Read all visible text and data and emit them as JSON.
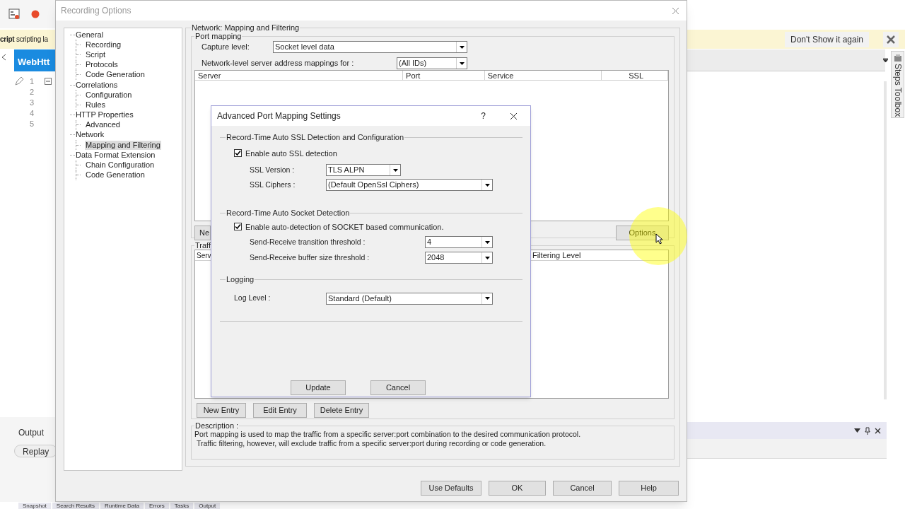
{
  "background_app": {
    "script_banner": "**cript** scripting la",
    "dont_show_button": "Don't Show it again",
    "editor_tab": "WebHtt",
    "line_numbers": [
      "1",
      "2",
      "3",
      "4",
      "5"
    ],
    "steps_toolbox": "Steps Toolbox",
    "output_panel": {
      "title": "Output",
      "replay_button": "Replay"
    },
    "bottom_tabs": [
      "Snapshot",
      "Search Results",
      "Runtime Data",
      "Errors",
      "Tasks",
      "Output"
    ]
  },
  "recording_options": {
    "title": "Recording Options",
    "tree": [
      {
        "label": "General",
        "selected": false,
        "children": [
          {
            "label": "Recording",
            "selected": false
          },
          {
            "label": "Script",
            "selected": false
          },
          {
            "label": "Protocols",
            "selected": false
          },
          {
            "label": "Code Generation",
            "selected": false
          }
        ]
      },
      {
        "label": "Correlations",
        "selected": false,
        "children": [
          {
            "label": "Configuration",
            "selected": false
          },
          {
            "label": "Rules",
            "selected": false
          }
        ]
      },
      {
        "label": "HTTP Properties",
        "selected": false,
        "children": [
          {
            "label": "Advanced",
            "selected": false
          }
        ]
      },
      {
        "label": "Network",
        "selected": false,
        "children": [
          {
            "label": "Mapping and Filtering",
            "selected": true
          }
        ]
      },
      {
        "label": "Data Format Extension",
        "selected": false,
        "children": [
          {
            "label": "Chain Configuration",
            "selected": false
          },
          {
            "label": "Code Generation",
            "selected": false
          }
        ]
      }
    ],
    "section_title": "Network: Mapping and Filtering",
    "port_mapping": {
      "title": "Port mapping",
      "capture_level_label": "Capture level:",
      "capture_level": "Socket level data",
      "mappings_label": "Network-level server address mappings for :",
      "mappings_for": "(All IDs)",
      "columns": [
        "Server",
        "Port",
        "Service",
        "SSL"
      ],
      "partial_button": "Ne",
      "options_button": "Options"
    },
    "traffic_filtering": {
      "title": "Traff",
      "columns": [
        "Serv",
        "Filtering Level"
      ],
      "buttons": [
        "New Entry",
        "Edit Entry",
        "Delete Entry"
      ]
    },
    "description": {
      "title": "Description :",
      "lines": [
        "Port mapping is used to map the traffic from a specific server:port combination to the desired communication protocol.",
        "Traffic filtering, however, will exclude traffic from a specific server:port during recording or code generation."
      ]
    },
    "buttons": [
      "Use Defaults",
      "OK",
      "Cancel",
      "Help"
    ]
  },
  "advanced_dialog": {
    "title": "Advanced Port Mapping Settings",
    "help": "?",
    "ssl_group": {
      "title": "Record-Time Auto SSL Detection and Configuration",
      "checkbox": {
        "label": "Enable auto SSL detection",
        "checked": true
      },
      "ssl_version_label": "SSL Version :",
      "ssl_version": "TLS ALPN",
      "ssl_ciphers_label": "SSL Ciphers :",
      "ssl_ciphers": "(Default OpenSsl Ciphers)"
    },
    "socket_group": {
      "title": "Record-Time Auto Socket Detection",
      "checkbox": {
        "label": "Enable auto-detection of SOCKET based communication.",
        "checked": true
      },
      "transition_label": "Send-Receive transition threshold :",
      "transition": "4",
      "buffer_label": "Send-Receive buffer size threshold :",
      "buffer": "2048"
    },
    "logging_group": {
      "title": "Logging",
      "log_level_label": "Log Level :",
      "log_level": "Standard (Default)"
    },
    "buttons": [
      "Update",
      "Cancel"
    ]
  }
}
